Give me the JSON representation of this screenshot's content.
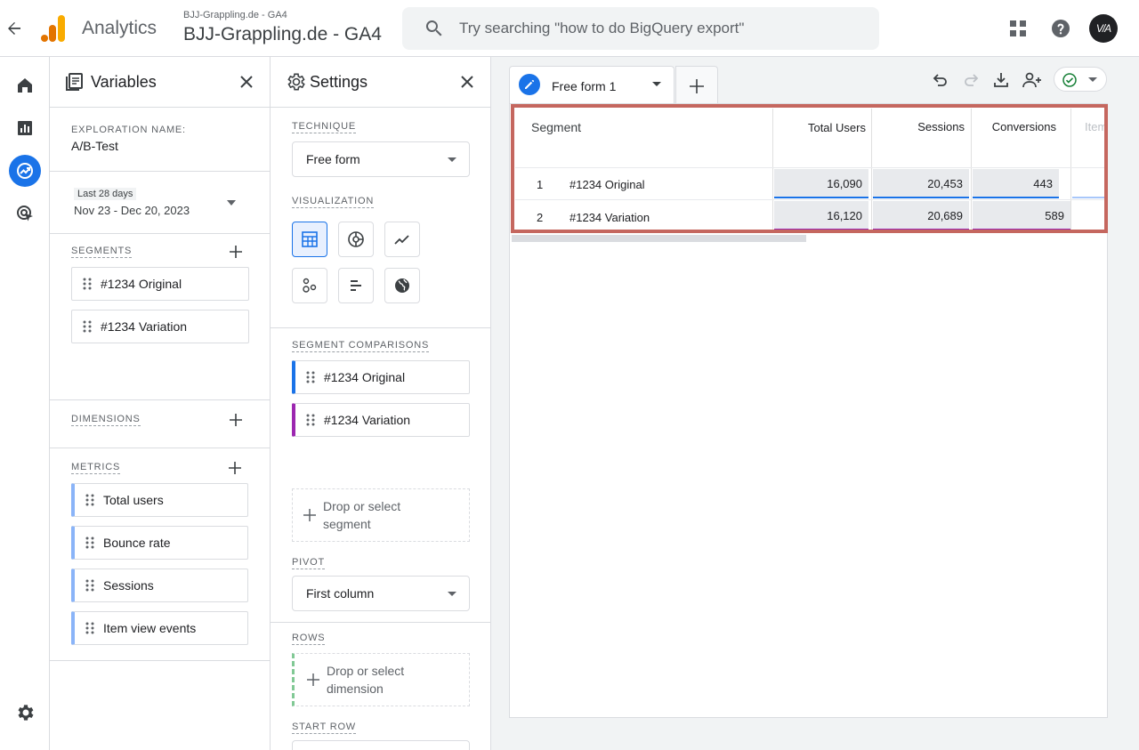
{
  "header": {
    "app_name": "Analytics",
    "property_sub": "BJJ-Grappling.de - GA4",
    "property_main": "BJJ-Grappling.de - GA4",
    "search_placeholder": "Try searching \"how to do BigQuery export\"",
    "avatar_text": "V/A"
  },
  "variables": {
    "title": "Variables",
    "exploration_name_label": "EXPLORATION NAME:",
    "exploration_name": "A/B-Test",
    "date_chip": "Last 28 days",
    "date_range": "Nov 23 - Dec 20, 2023",
    "segments_label": "SEGMENTS",
    "segments": [
      "#1234 Original",
      "#1234 Variation"
    ],
    "dimensions_label": "DIMENSIONS",
    "metrics_label": "METRICS",
    "metrics": [
      "Total users",
      "Bounce rate",
      "Sessions",
      "Item view events"
    ]
  },
  "settings": {
    "title": "Settings",
    "technique_label": "TECHNIQUE",
    "technique_value": "Free form",
    "visualization_label": "VISUALIZATION",
    "visualizations": [
      "table-icon",
      "donut-chart-icon",
      "line-chart-icon",
      "scatter-plot-icon",
      "bar-chart-icon",
      "geo-map-icon"
    ],
    "segment_comparisons_label": "SEGMENT COMPARISONS",
    "segment_comparisons": [
      "#1234 Original",
      "#1234 Variation"
    ],
    "drop_segment_line1": "Drop or select",
    "drop_segment_line2": "segment",
    "pivot_label": "PIVOT",
    "pivot_value": "First column",
    "rows_label": "ROWS",
    "drop_dimension_line1": "Drop or select",
    "drop_dimension_line2": "dimension",
    "start_row_label": "START ROW"
  },
  "canvas": {
    "tab_label": "Free form 1",
    "table": {
      "segment_header": "Segment",
      "columns": [
        "Total Users",
        "Sessions",
        "Conversions",
        "Item"
      ],
      "rows": [
        {
          "index": "1",
          "segment": "#1234 Original",
          "values": [
            "16,090",
            "20,453",
            "443"
          ]
        },
        {
          "index": "2",
          "segment": "#1234 Variation",
          "values": [
            "16,120",
            "20,689",
            "589"
          ]
        }
      ]
    }
  },
  "colors": {
    "accent": "#1a73e8",
    "segment_original": "#1a73e8",
    "segment_variation": "#9c27b0",
    "highlight_box": "#c5675f",
    "logo_orange": "#f9ab00",
    "logo_dark_orange": "#e37400",
    "success_green": "#188038"
  }
}
